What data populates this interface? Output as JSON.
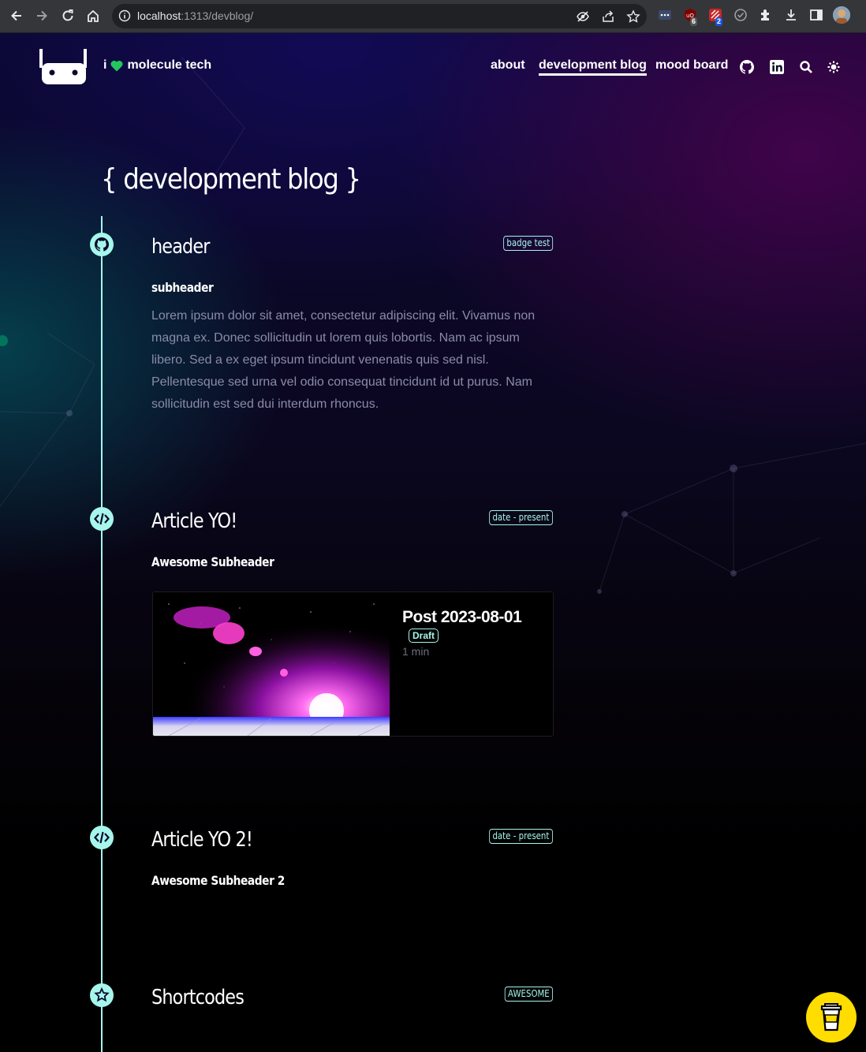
{
  "browser": {
    "url_host": "localhost",
    "url_path": ":1313/devblog/",
    "ext_ublock_count": "6",
    "ext_second_count": "2"
  },
  "site": {
    "brand_prefix": "i",
    "brand_name": "molecule tech",
    "nav": [
      "about",
      "development blog",
      "mood board"
    ],
    "active_nav": "development blog"
  },
  "page": {
    "title": "{ development blog }"
  },
  "timeline": [
    {
      "icon": "github-icon",
      "title": "header",
      "badge": "badge test",
      "subheader": "subheader",
      "body": "Lorem ipsum dolor sit amet, consectetur adipiscing elit. Vivamus non magna ex. Donec sollicitudin ut lorem quis lobortis. Nam ac ipsum libero. Sed a ex eget ipsum tincidunt venenatis quis sed nisl. Pellentesque sed urna vel odio consequat tincidunt id ut purus. Nam sollicitudin est sed dui interdum rhoncus."
    },
    {
      "icon": "code-icon",
      "title": "Article YO!",
      "badge": "date - present",
      "subheader": "Awesome Subheader",
      "card": {
        "title": "Post 2023-08-01",
        "status": "Draft",
        "read_time": "1 min"
      }
    },
    {
      "icon": "code-icon",
      "title": "Article YO 2!",
      "badge": "date - present",
      "subheader": "Awesome Subheader 2"
    },
    {
      "icon": "star-icon",
      "title": "Shortcodes",
      "badge": "AWESOME"
    }
  ],
  "colors": {
    "accent": "#a6f6ec",
    "body_text": "#8b8ba8",
    "heart": "#22c55e",
    "coffee": "#ffdd00"
  }
}
